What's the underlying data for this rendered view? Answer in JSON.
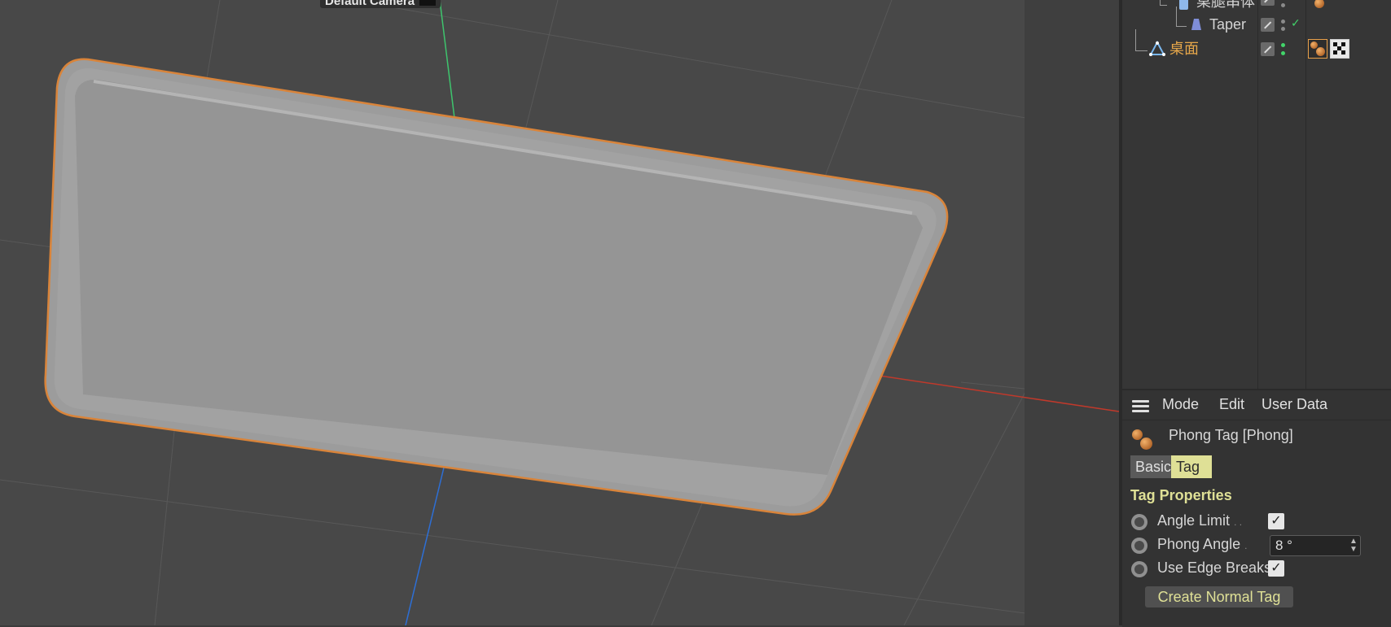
{
  "viewport": {
    "camera_label": "Default Camera",
    "colors": {
      "background": "#484848",
      "selection": "#d9843a",
      "x_axis": "#c0392b",
      "y_axis": "#3ec46d",
      "z_axis": "#2d6fd6"
    }
  },
  "object_manager": {
    "rows": [
      {
        "name": "桌腿串体",
        "icon": "null-cylinder-icon",
        "selected": false
      },
      {
        "name": "Taper",
        "icon": "taper-deformer-icon",
        "selected": false
      },
      {
        "name": "桌面",
        "icon": "polygon-object-icon",
        "selected": true
      }
    ]
  },
  "attributes": {
    "menu": {
      "mode": "Mode",
      "edit": "Edit",
      "user_data": "User Data"
    },
    "object_title": "Phong Tag [Phong]",
    "tabs": {
      "basic": "Basic",
      "tag": "Tag"
    },
    "active_tab": "Tag",
    "section_title": "Tag Properties",
    "properties": {
      "angle_limit": {
        "label": "Angle Limit",
        "dots": ". .",
        "checked": true
      },
      "phong_angle": {
        "label": "Phong Angle",
        "dots": ".",
        "value": "8 °"
      },
      "use_edge_breaks": {
        "label": "Use Edge Breaks",
        "checked": true
      }
    },
    "create_button": "Create Normal Tag",
    "accent_color": "#dfe096"
  }
}
